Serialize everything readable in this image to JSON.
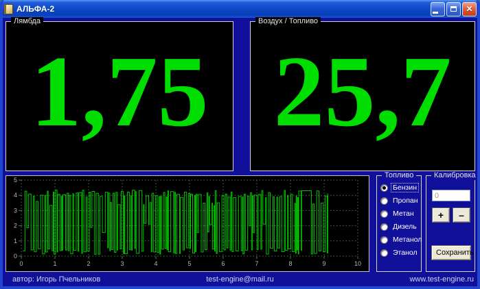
{
  "window": {
    "title": "АЛЬФА-2",
    "close_glyph": "✕"
  },
  "displays": {
    "lambda": {
      "label": "Лямбда",
      "value": "1,75"
    },
    "airfuel": {
      "label": "Воздух / Топливо",
      "value": "25,7"
    }
  },
  "chart_data": {
    "type": "line",
    "title": "",
    "xlabel": "",
    "ylabel": "",
    "xlim": [
      0,
      10
    ],
    "ylim": [
      0,
      5
    ],
    "x_ticks": [
      "0",
      "1",
      "2",
      "3",
      "4",
      "5",
      "6",
      "7",
      "8",
      "9",
      "10"
    ],
    "y_ticks": [
      "0",
      "1",
      "2",
      "3",
      "4",
      "5"
    ],
    "grid": true,
    "legend": "none",
    "line_color": "#00c400",
    "grid_color": "#4a7a4a",
    "tick_label_color": "#b8b8b8",
    "signal": {
      "description": "lambda-sensor style square-wave oscillation between ~0.2 and ~4.3 V",
      "seed": 11,
      "x_start": 0.05,
      "x_end": 9.12,
      "low_min": 0.12,
      "low_max": 0.55,
      "high_min": 3.85,
      "high_max": 4.35,
      "plateau": {
        "from": 8.33,
        "to": 8.62,
        "value": 4.3
      }
    }
  },
  "fuel": {
    "label": "Топливо",
    "options": [
      {
        "label": "Бензин",
        "selected": true
      },
      {
        "label": "Пропан",
        "selected": false
      },
      {
        "label": "Метан",
        "selected": false
      },
      {
        "label": "Дизель",
        "selected": false
      },
      {
        "label": "Метанол",
        "selected": false
      },
      {
        "label": "Этанол",
        "selected": false
      }
    ]
  },
  "calibration": {
    "label": "Калибровка",
    "input_value": "0",
    "plus_label": "+",
    "minus_label": "–",
    "save_label": "Сохранить"
  },
  "footer": {
    "author": "автор: Игорь Пчельников",
    "email": "test-engine@mail.ru",
    "website": "www.test-engine.ru"
  },
  "colors": {
    "value_green": "#00dd00",
    "client_bg": "#10109a",
    "panel_black": "#000000",
    "frame_blue": "#2146d0",
    "groupbox_border": "#d4d4d4"
  }
}
